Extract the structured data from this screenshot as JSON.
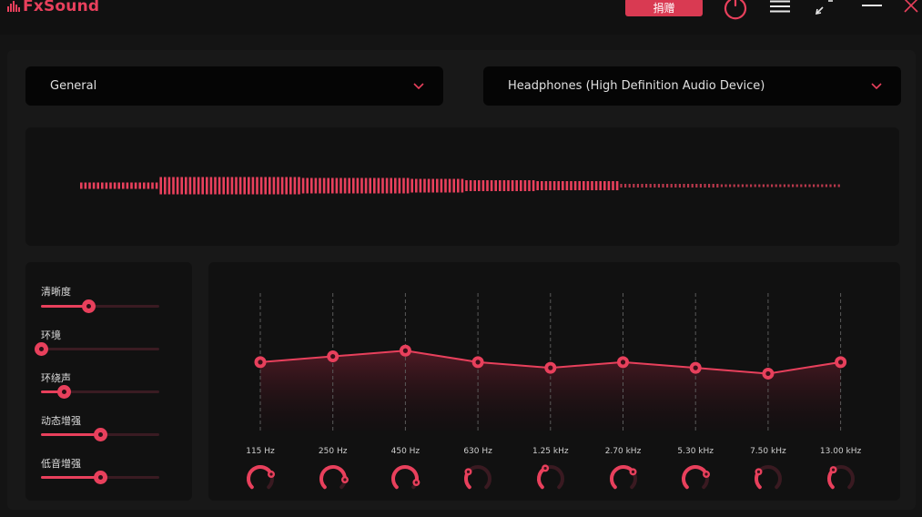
{
  "app": {
    "name": "FxSound"
  },
  "titlebar": {
    "donate_label": "捐赠",
    "icons": [
      "power-icon",
      "menu-icon",
      "minimize-to-tray-icon",
      "minimize-icon",
      "close-icon"
    ]
  },
  "preset_dropdown": {
    "value": "General"
  },
  "device_dropdown": {
    "value": "Headphones (High Definition Audio Device)"
  },
  "sliders": [
    {
      "label": "清晰度",
      "value": 0.4
    },
    {
      "label": "环境",
      "value": 0.0
    },
    {
      "label": "环绕声",
      "value": 0.19
    },
    {
      "label": "动态增强",
      "value": 0.5
    },
    {
      "label": "低音增强",
      "value": 0.5
    }
  ],
  "eq_bands": [
    {
      "label": "115 Hz",
      "gain": 0.5,
      "knob": 0.75
    },
    {
      "label": "250 Hz",
      "gain": 1.5,
      "knob": 0.85
    },
    {
      "label": "450 Hz",
      "gain": 2.5,
      "knob": 0.9
    },
    {
      "label": "630 Hz",
      "gain": 0.5,
      "knob": 0.3
    },
    {
      "label": "1.25 kHz",
      "gain": -0.5,
      "knob": 0.4
    },
    {
      "label": "2.70 kHz",
      "gain": 0.5,
      "knob": 0.7
    },
    {
      "label": "5.30 kHz",
      "gain": -0.5,
      "knob": 0.75
    },
    {
      "label": "7.50 kHz",
      "gain": -1.5,
      "knob": 0.3
    },
    {
      "label": "13.00 kHz",
      "gain": 0.5,
      "knob": 0.35
    }
  ],
  "colors": {
    "accent": "#e8405c",
    "background": "#141414",
    "panel": "#111111",
    "dropdown": "#050505"
  }
}
